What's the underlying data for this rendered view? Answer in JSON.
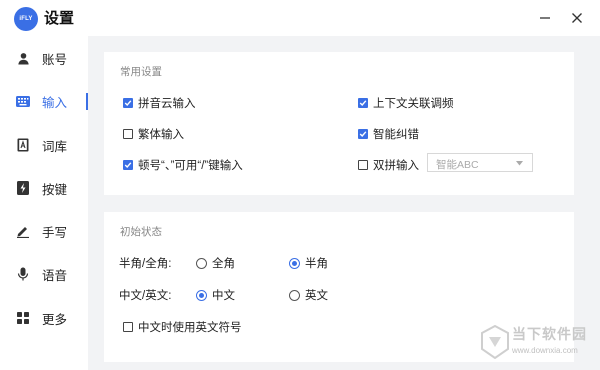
{
  "app": {
    "logo_text": "iFLY",
    "title": "设置"
  },
  "sidebar": {
    "items": [
      {
        "label": "账号",
        "icon": "user-icon"
      },
      {
        "label": "输入",
        "icon": "keyboard-icon",
        "active": true
      },
      {
        "label": "词库",
        "icon": "book-icon"
      },
      {
        "label": "按键",
        "icon": "lightning-icon"
      },
      {
        "label": "手写",
        "icon": "pen-icon"
      },
      {
        "label": "语音",
        "icon": "microphone-icon"
      },
      {
        "label": "更多",
        "icon": "grid-icon"
      }
    ]
  },
  "common": {
    "title": "常用设置",
    "options": {
      "pinyin_cloud": {
        "label": "拼音云输入",
        "checked": true
      },
      "context_freq": {
        "label": "上下文关联调频",
        "checked": true
      },
      "traditional": {
        "label": "繁体输入",
        "checked": false
      },
      "smart_correct": {
        "label": "智能纠错",
        "checked": true
      },
      "punctuation": {
        "label": "顿号“、”可用“/”键输入",
        "checked": true
      },
      "double_pinyin": {
        "label": "双拼输入",
        "checked": false
      }
    },
    "double_pinyin_scheme": "智能ABC"
  },
  "initial": {
    "title": "初始状态",
    "width_label": "半角/全角:",
    "width_full": "全角",
    "width_half": "半角",
    "width_selected": "半角",
    "lang_label": "中文/英文:",
    "lang_cn": "中文",
    "lang_en": "英文",
    "lang_selected": "中文",
    "en_symbols": {
      "label": "中文时使用英文符号",
      "checked": false
    }
  },
  "watermark": {
    "brand": "当下软件园",
    "url": "www.downxia.com"
  },
  "colors": {
    "accent": "#3a6fe5",
    "content_bg": "#f2f3f5"
  }
}
